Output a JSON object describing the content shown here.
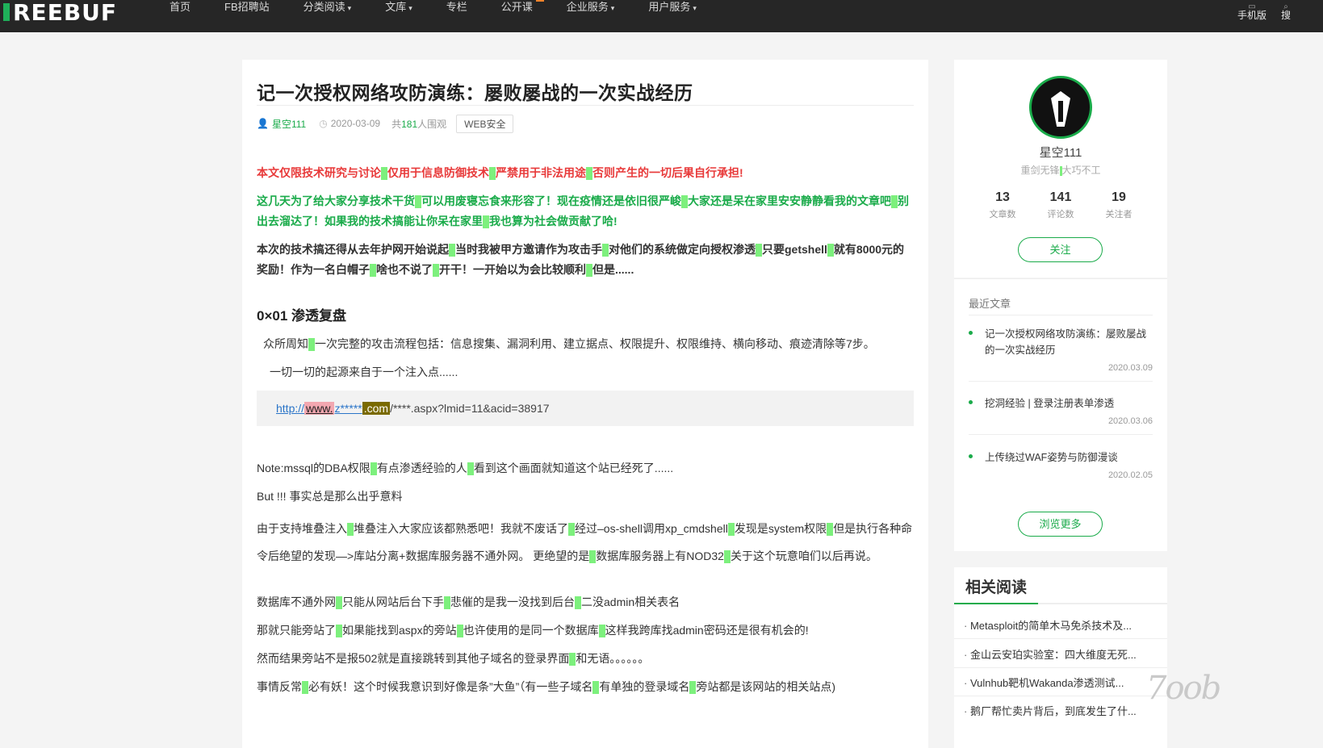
{
  "nav": {
    "logo": "REEBUF",
    "items": [
      "首页",
      "FB招聘站",
      "分类阅读",
      "文库",
      "专栏",
      "公开课",
      "企业服务",
      "用户服务"
    ],
    "dropdown_items": [
      false,
      false,
      true,
      true,
      false,
      false,
      true,
      true
    ],
    "mobile": "手机版",
    "search": "搜"
  },
  "article": {
    "title": "记一次授权网络攻防演练：屡败屡战的一次实战经历",
    "author": "星空111",
    "date": "2020-03-09",
    "views_prefix": "共",
    "views": "181",
    "views_suffix": "人围观",
    "tag": "WEB安全",
    "p1": [
      "本文仅限技术研究与讨论",
      "仅用于信息防御技术",
      "严禁用于非法用途",
      "否则产生的一切后果自行承担!"
    ],
    "p2": [
      "这几天为了给大家分享技术干货",
      "可以用废寝忘食来形容了！现在疫情还是依旧很严峻",
      "大家还是呆在家里安安静静看我的文章吧",
      "别出去溜达了！如果我的技术搞能让你呆在家里",
      "我也算为社会做贡献了哈!"
    ],
    "p3": [
      "本次的技术搞还得从去年护网开始说起",
      "当时我被甲方邀请作为攻击手",
      "对他们的系统做定向授权渗透",
      "只要getshell",
      "就有8000元的奖励！作为一名白帽子",
      "啥也不说了",
      "开干！一开始以为会比较顺利",
      "但是......"
    ],
    "h_section": "0×01 渗透复盘",
    "p4": [
      "众所周知",
      "一次完整的攻击流程包括：信息搜集、漏洞利用、建立据点、权限提升、权限维持、横向移动、痕迹清除等7步。"
    ],
    "p5": "一切一切的起源来自于一个注入点......",
    "url": {
      "a": "http://",
      "b": "www.",
      "c": "z*****",
      "d": ".com",
      "e": "/****.aspx?lmid=11&acid=38917"
    },
    "p6": [
      "Note:mssql的DBA权限",
      "有点渗透经验的人",
      "看到这个画面就知道这个站已经死了......"
    ],
    "p7": "But !!! 事实总是那么出乎意料",
    "p8": [
      "由于支持堆叠注入",
      "堆叠注入大家应该都熟悉吧！我就不废话了",
      "经过–os-shell调用xp_cmdshell",
      "发现是system权限",
      "但是执行各种命令后绝望的发现—>库站分离+数据库服务器不通外网。 更绝望的是",
      "数据库服务器上有NOD32",
      "关于这个玩意咱们以后再说。"
    ],
    "p9": [
      "数据库不通外网",
      "只能从网站后台下手",
      "悲催的是我一没找到后台",
      "二没admin相关表名"
    ],
    "p10": [
      "那就只能旁站了",
      "如果能找到aspx的旁站",
      "也许使用的是同一个数据库",
      "这样我跨库找admin密码还是很有机会的!"
    ],
    "p11": [
      "然而结果旁站不是报502就是直接跳转到其他子域名的登录界面",
      "和无语。。。。。。"
    ],
    "p12": [
      "事情反常",
      "必有妖！这个时候我意识到好像是条”大鱼”（有一些子域名",
      "有单独的登录域名",
      "旁站都是该网站的相关站点)"
    ]
  },
  "profile": {
    "name": "星空111",
    "motto_a": "重剑无锋",
    "motto_b": "大巧不工",
    "articles": "13",
    "articles_label": "文章数",
    "comments": "141",
    "comments_label": "评论数",
    "followers": "19",
    "followers_label": "关注者",
    "follow_btn": "关注"
  },
  "recent": {
    "heading": "最近文章",
    "items": [
      {
        "title": "记一次授权网络攻防演练：屡败屡战的一次实战经历",
        "date": "2020.03.09"
      },
      {
        "title": "挖洞经验 | 登录注册表单渗透",
        "date": "2020.03.06"
      },
      {
        "title": "上传绕过WAF姿势与防御漫谈",
        "date": "2020.02.05"
      }
    ],
    "more_btn": "浏览更多"
  },
  "related": {
    "heading": "相关阅读",
    "items": [
      "Metasploit的简单木马免杀技术及...",
      "金山云安珀实验室：四大维度无死...",
      "Vulnhub靶机Wakanda渗透测试...",
      "鹅厂帮忙卖片背后，到底发生了什..."
    ]
  },
  "watermark": "7oob"
}
